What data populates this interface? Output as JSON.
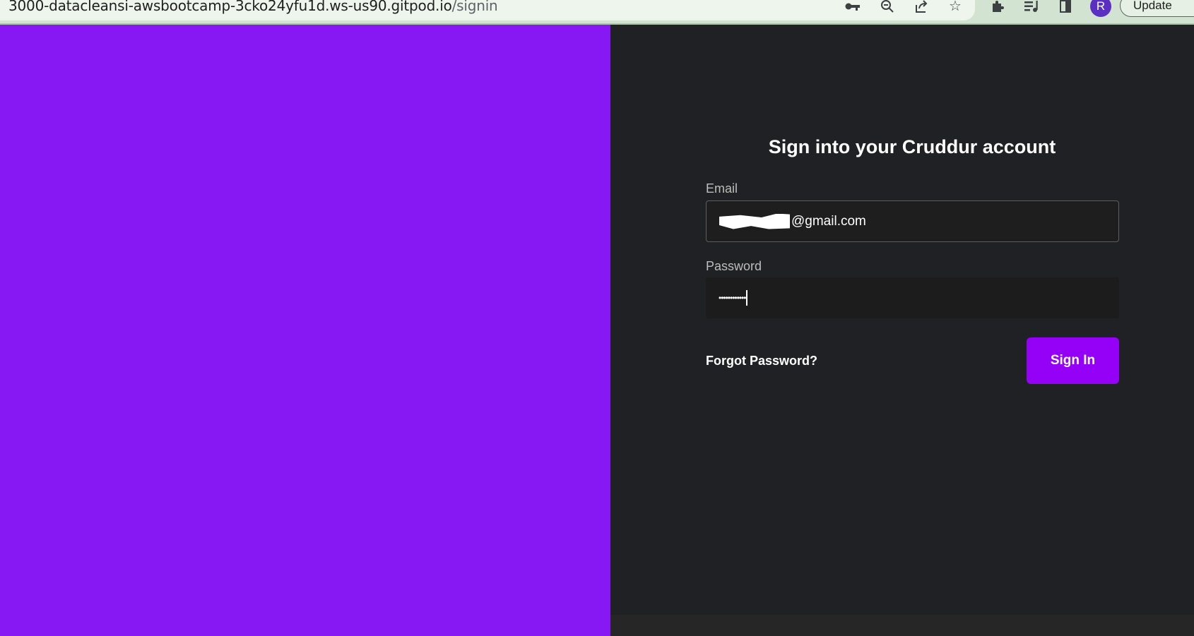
{
  "browser": {
    "url_host": "3000-datacleansi-awsbootcamp-3cko24yfu1d.ws-us90.gitpod.io",
    "url_path": "/signin",
    "profile_initial": "R",
    "update_label": "Update",
    "icons": [
      "key-icon",
      "zoom-out-icon",
      "share-icon",
      "star-icon",
      "extensions-icon",
      "media-controls-icon",
      "side-panel-icon"
    ]
  },
  "colors": {
    "left_panel": "#8717f3",
    "right_panel": "#202124",
    "accent_button": "#9500f6"
  },
  "signin": {
    "title": "Sign into your Cruddur account",
    "email_label": "Email",
    "email_value_visible": "@gmail.com",
    "password_label": "Password",
    "password_masked": "••••••••••••",
    "forgot_label": "Forgot Password?",
    "submit_label": "Sign In"
  }
}
